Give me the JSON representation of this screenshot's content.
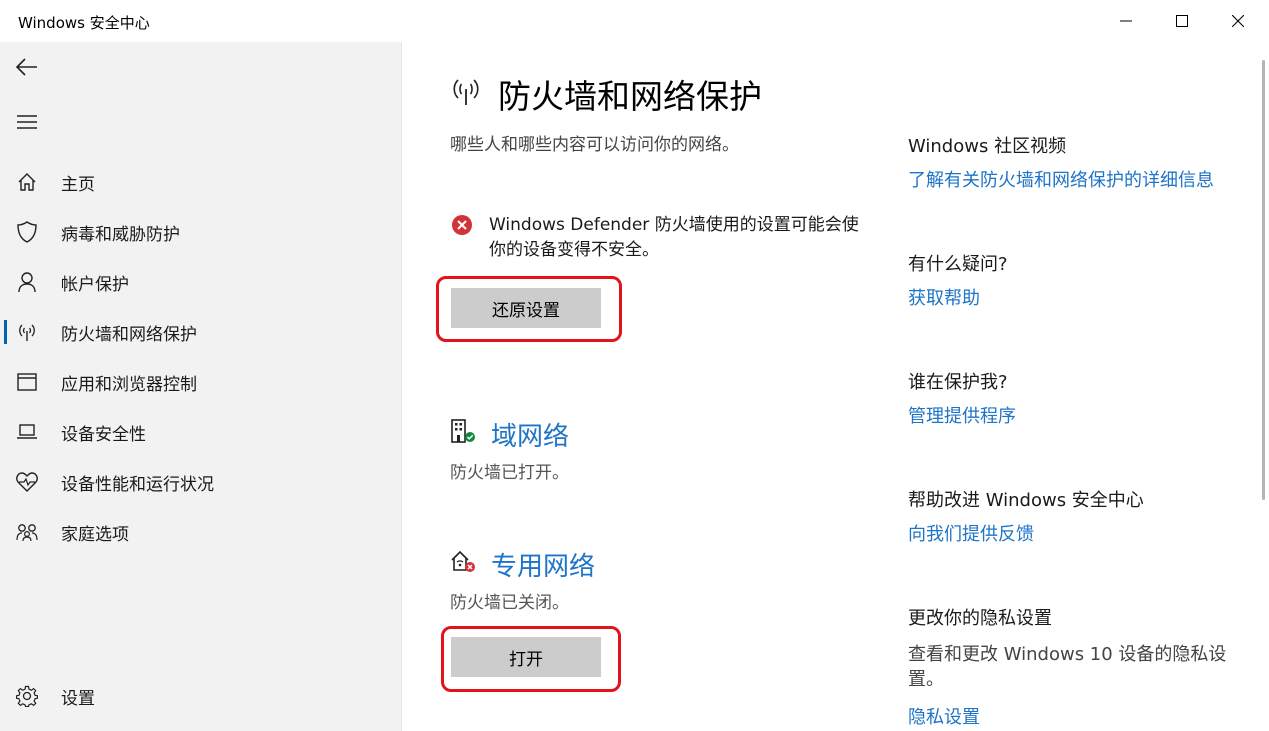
{
  "window": {
    "title": "Windows 安全中心"
  },
  "sidebar": {
    "items": [
      {
        "label": "主页",
        "icon": "home-icon"
      },
      {
        "label": "病毒和威胁防护",
        "icon": "shield-icon"
      },
      {
        "label": "帐户保护",
        "icon": "person-icon"
      },
      {
        "label": "防火墙和网络保护",
        "icon": "antenna-icon",
        "active": true
      },
      {
        "label": "应用和浏览器控制",
        "icon": "app-window-icon"
      },
      {
        "label": "设备安全性",
        "icon": "laptop-icon"
      },
      {
        "label": "设备性能和运行状况",
        "icon": "heart-pulse-icon"
      },
      {
        "label": "家庭选项",
        "icon": "family-icon"
      }
    ],
    "settings_label": "设置"
  },
  "main": {
    "title": "防火墙和网络保护",
    "subtitle": "哪些人和哪些内容可以访问你的网络。",
    "warning": {
      "text": "Windows Defender 防火墙使用的设置可能会使你的设备变得不安全。",
      "button": "还原设置"
    },
    "networks": [
      {
        "name": "域网络",
        "status": "防火墙已打开。",
        "icon": "domain-network-icon"
      },
      {
        "name": "专用网络",
        "status": "防火墙已关闭。",
        "icon": "private-network-icon",
        "button": "打开"
      }
    ]
  },
  "right": {
    "community_head": "Windows 社区视频",
    "community_link": "了解有关防火墙和网络保护的详细信息",
    "question_head": "有什么疑问?",
    "question_link": "获取帮助",
    "protect_head": "谁在保护我?",
    "protect_link": "管理提供程序",
    "improve_head": "帮助改进 Windows 安全中心",
    "improve_link": "向我们提供反馈",
    "privacy_head": "更改你的隐私设置",
    "privacy_text": "查看和更改 Windows 10 设备的隐私设置。",
    "privacy_link": "隐私设置"
  },
  "colors": {
    "accent": "#1e74c7",
    "active_bar": "#0063b1",
    "error": "#d13438",
    "annotation": "#e3131d",
    "sidebar_bg": "#f2f2f2",
    "button_bg": "#cccccc"
  }
}
